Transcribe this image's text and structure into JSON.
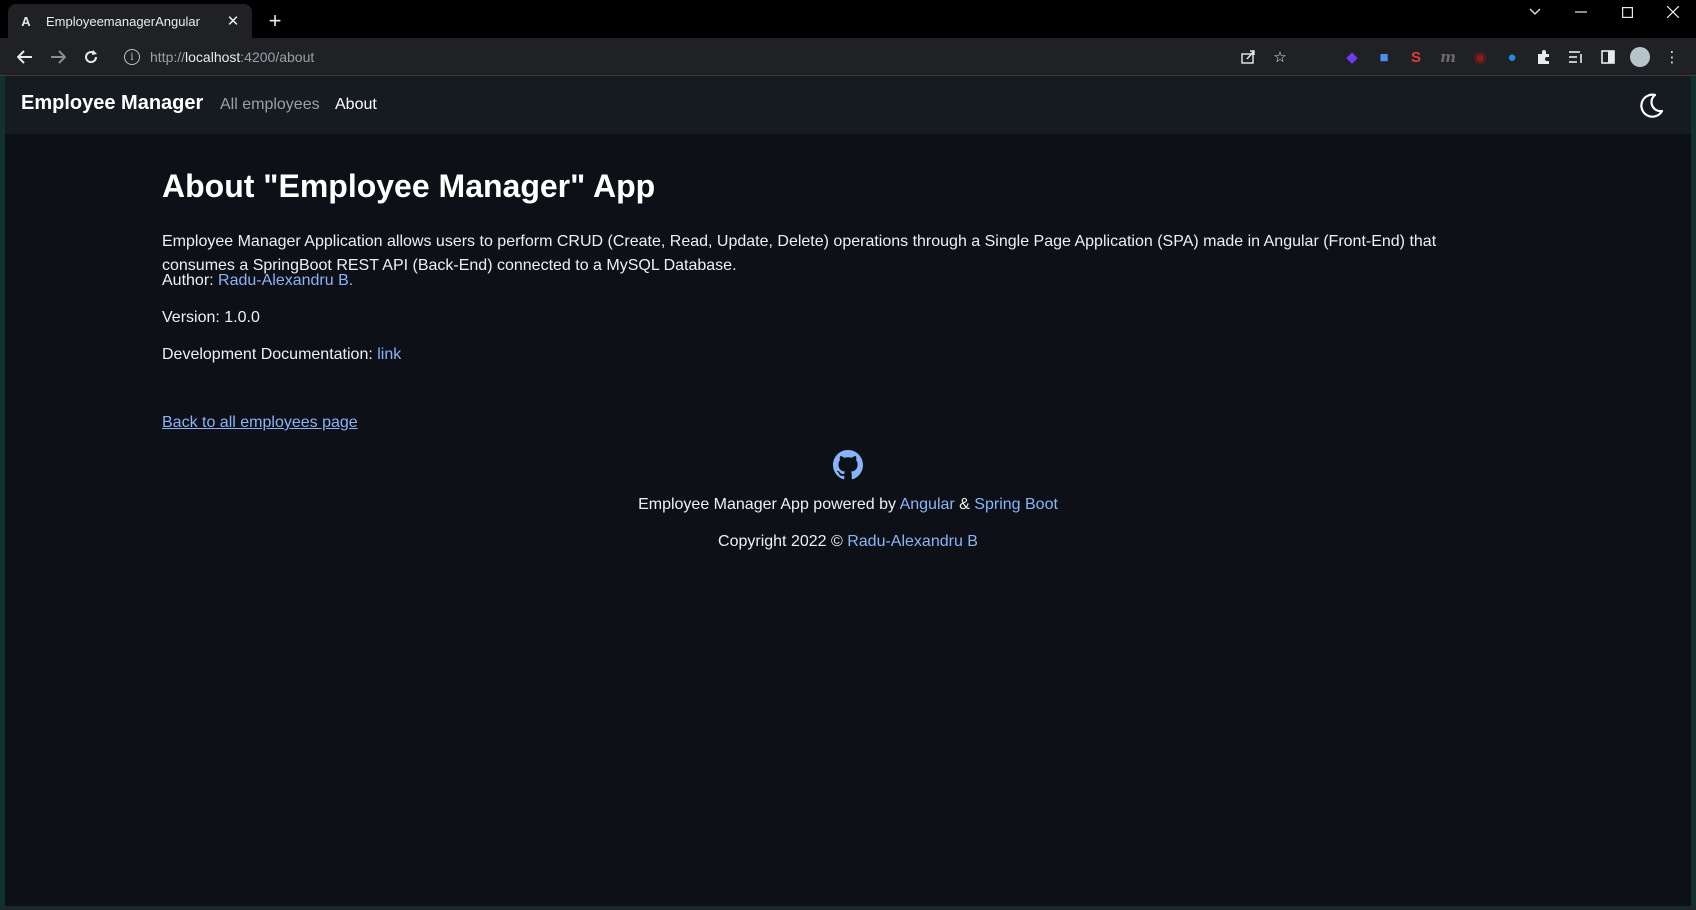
{
  "browser": {
    "tab_title": "EmployeemanagerAngular",
    "tab_favicon": "A",
    "url_prefix": "http://",
    "url_host": "localhost",
    "url_path": ":4200/about"
  },
  "navbar": {
    "brand": "Employee Manager",
    "links": [
      {
        "label": "All employees",
        "active": false
      },
      {
        "label": "About",
        "active": true
      }
    ],
    "theme_icon": "moon-icon"
  },
  "about": {
    "title": "About \"Employee Manager\" App",
    "description": "Employee Manager Application allows users to perform CRUD (Create, Read, Update, Delete) operations through a Single Page Application (SPA) made in Angular (Front-End) that consumes a SpringBoot REST API (Back-End) connected to a MySQL Database.",
    "author_label": "Author: ",
    "author_name": "Radu-Alexandru B.",
    "version": "Version: 1.0.0",
    "docs_label": "Development Documentation: ",
    "docs_link": "link",
    "back_link": "Back to all employees page"
  },
  "footer": {
    "icon": "github-icon",
    "powered_prefix": "Employee Manager App powered by ",
    "angular": "Angular",
    "amp": " & ",
    "spring": "Spring Boot",
    "copyright_prefix": "Copyright 2022 © ",
    "copyright_name": "Radu-Alexandru B"
  },
  "colors": {
    "background": "#0d1117",
    "navbar": "#161b22",
    "link": "#8ab4f8",
    "text": "#f0f0f0"
  }
}
